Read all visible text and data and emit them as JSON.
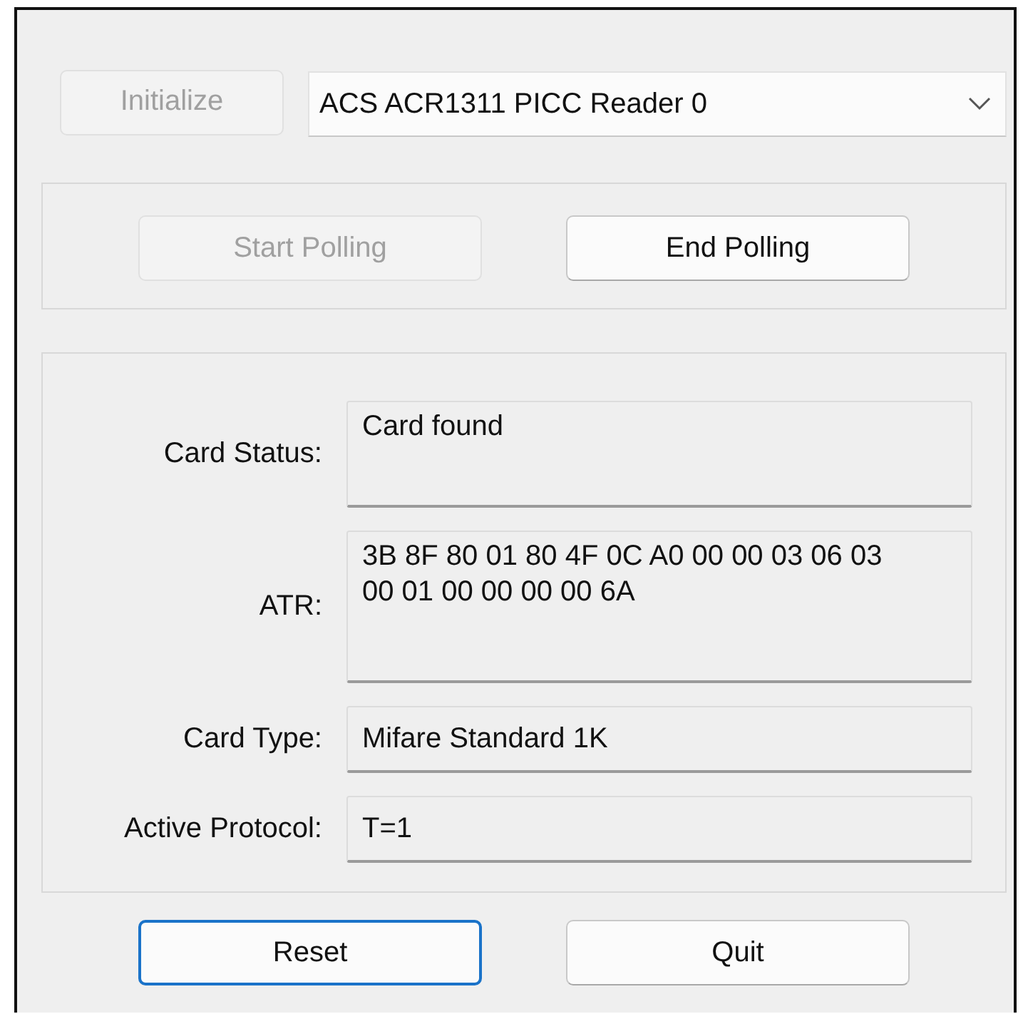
{
  "initialize_button": {
    "label": "Initialize",
    "disabled": true
  },
  "reader_select": {
    "value": "ACS ACR1311 PICC Reader 0"
  },
  "polling_buttons": [
    {
      "label": "Start Polling",
      "disabled": true
    },
    {
      "label": "End Polling",
      "disabled": false
    }
  ],
  "card_fields": [
    {
      "label": "Card Status:",
      "value": "Card found",
      "kind": "multiline"
    },
    {
      "label": "ATR:",
      "value": "3B 8F 80 01 80 4F 0C A0 00 00 03 06 03 00 01 00 00 00 00 6A",
      "kind": "multiline"
    },
    {
      "label": "Card Type:",
      "value": "Mifare Standard 1K",
      "kind": "single"
    },
    {
      "label": "Active Protocol:",
      "value": "T=1",
      "kind": "single"
    }
  ],
  "bottom_buttons": [
    {
      "label": "Reset",
      "focused": true
    },
    {
      "label": "Quit",
      "focused": false
    }
  ]
}
